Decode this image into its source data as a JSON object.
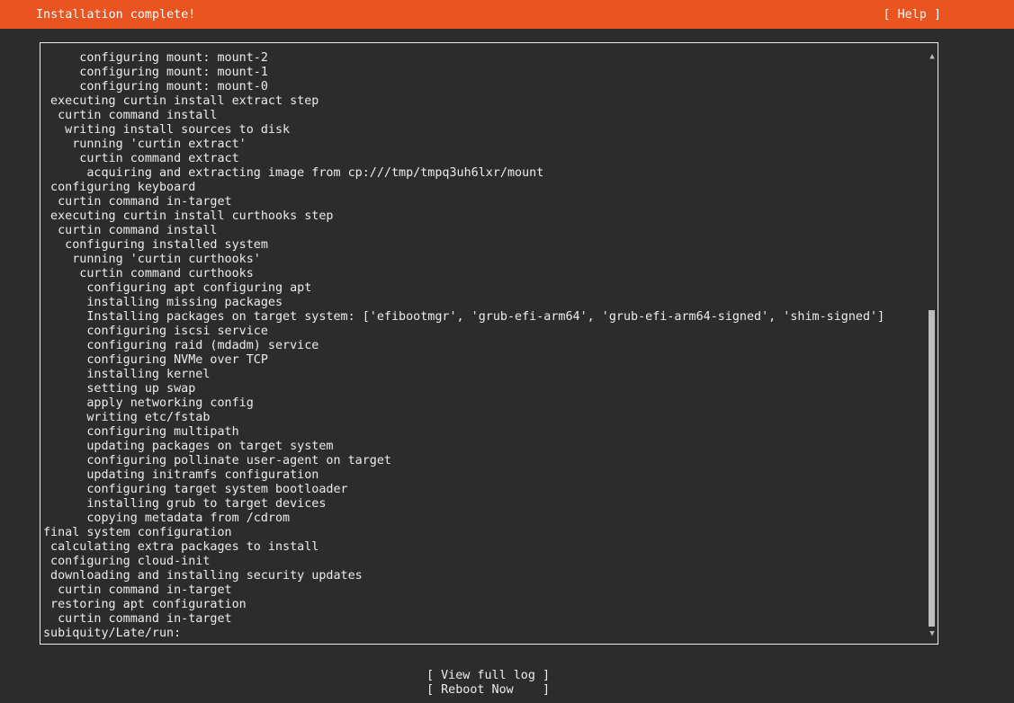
{
  "header": {
    "title": "Installation complete!",
    "help_label": "[ Help ]"
  },
  "log": {
    "lines": [
      "     configuring mount: mount-2",
      "     configuring mount: mount-1",
      "     configuring mount: mount-0",
      " executing curtin install extract step",
      "  curtin command install",
      "   writing install sources to disk",
      "    running 'curtin extract'",
      "     curtin command extract",
      "      acquiring and extracting image from cp:///tmp/tmpq3uh6lxr/mount",
      " configuring keyboard",
      "  curtin command in-target",
      " executing curtin install curthooks step",
      "  curtin command install",
      "   configuring installed system",
      "    running 'curtin curthooks'",
      "     curtin command curthooks",
      "      configuring apt configuring apt",
      "      installing missing packages",
      "      Installing packages on target system: ['efibootmgr', 'grub-efi-arm64', 'grub-efi-arm64-signed', 'shim-signed']",
      "      configuring iscsi service",
      "      configuring raid (mdadm) service",
      "      configuring NVMe over TCP",
      "      installing kernel",
      "      setting up swap",
      "      apply networking config",
      "      writing etc/fstab",
      "      configuring multipath",
      "      updating packages on target system",
      "      configuring pollinate user-agent on target",
      "      updating initramfs configuration",
      "      configuring target system bootloader",
      "      installing grub to target devices",
      "      copying metadata from /cdrom",
      "final system configuration",
      " calculating extra packages to install",
      " configuring cloud-init",
      " downloading and installing security updates",
      "  curtin command in-target",
      " restoring apt configuration",
      "  curtin command in-target",
      "subiquity/Late/run:"
    ]
  },
  "scrollbar": {
    "up_glyph": "▲",
    "down_glyph": "▼"
  },
  "actions": {
    "view_full_log": "[ View full log ]",
    "reboot_now": "[ Reboot Now    ]"
  },
  "colors": {
    "accent": "#e95420",
    "background": "#2c2c2c",
    "text": "#ececec"
  }
}
